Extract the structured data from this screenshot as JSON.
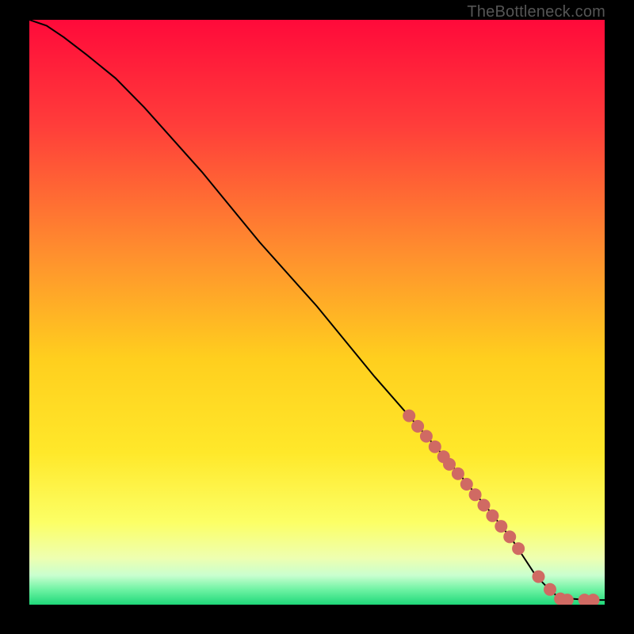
{
  "watermark": "TheBottleneck.com",
  "colors": {
    "gradient": [
      {
        "id": "g0",
        "offset": 0.0,
        "hex": "#ff0a3a"
      },
      {
        "id": "g1",
        "offset": 0.18,
        "hex": "#ff3d3a"
      },
      {
        "id": "g2",
        "offset": 0.4,
        "hex": "#ff8f2e"
      },
      {
        "id": "g3",
        "offset": 0.58,
        "hex": "#ffcf1e"
      },
      {
        "id": "g4",
        "offset": 0.74,
        "hex": "#ffe82a"
      },
      {
        "id": "g5",
        "offset": 0.86,
        "hex": "#fcff66"
      },
      {
        "id": "g6",
        "offset": 0.92,
        "hex": "#eeffb0"
      },
      {
        "id": "g7",
        "offset": 0.95,
        "hex": "#c9ffcf"
      },
      {
        "id": "g8",
        "offset": 0.975,
        "hex": "#6cf2a2"
      },
      {
        "id": "g9",
        "offset": 1.0,
        "hex": "#1fd879"
      }
    ],
    "marker": "#d06a63",
    "curve": "#000000"
  },
  "chart_data": {
    "type": "line",
    "title": "",
    "xlabel": "",
    "ylabel": "",
    "xlim": [
      0,
      100
    ],
    "ylim": [
      0,
      100
    ],
    "series": [
      {
        "name": "bottleneck-curve",
        "x": [
          0,
          3,
          6,
          10,
          15,
          20,
          30,
          40,
          50,
          60,
          68,
          75,
          80,
          84,
          86,
          88,
          90,
          92,
          97,
          100
        ],
        "y": [
          100,
          99,
          97,
          94,
          90,
          85,
          74,
          62,
          51,
          39,
          30,
          22,
          16,
          11,
          8,
          5,
          3,
          1.2,
          0.8,
          0.8
        ]
      }
    ],
    "markers": {
      "name": "highlighted-points",
      "color": "#d06a63",
      "radius_px": 8,
      "x": [
        66,
        67.5,
        69,
        70.5,
        72,
        73,
        74.5,
        76,
        77.5,
        79,
        80.5,
        82,
        83.5,
        85,
        88.5,
        90.5,
        92.3,
        93.5,
        96.5,
        98
      ],
      "y": [
        32.3,
        30.5,
        28.8,
        27.0,
        25.3,
        24.0,
        22.4,
        20.6,
        18.8,
        17.0,
        15.2,
        13.4,
        11.6,
        9.6,
        4.8,
        2.6,
        1.0,
        0.8,
        0.8,
        0.8
      ]
    }
  }
}
